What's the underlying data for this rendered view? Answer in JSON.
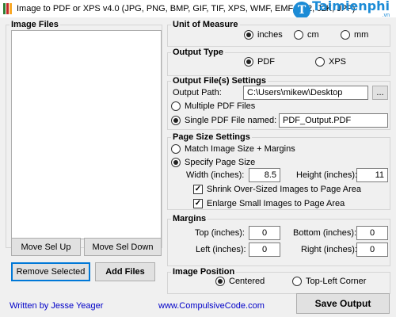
{
  "window": {
    "title": "Image to PDF or XPS  v4.0  (JPG, PNG, BMP, GIF, TIF, XPS, WMF, EMF, JP2, J2K, JPF)",
    "icon_colors": [
      "#2e7d32",
      "#c62828",
      "#f9a825"
    ]
  },
  "brand": {
    "name": "Taimienphi",
    "suffix": ".vn",
    "logo_letter": "T",
    "color": "#1b8bd6"
  },
  "image_files": {
    "title": "Image Files",
    "move_up": "Move Sel Up",
    "move_down": "Move Sel Down",
    "remove": "Remove Selected",
    "add": "Add Files"
  },
  "unit": {
    "title": "Unit of Measure",
    "inches": "inches",
    "cm": "cm",
    "mm": "mm",
    "selected": "inches"
  },
  "output_type": {
    "title": "Output Type",
    "pdf": "PDF",
    "xps": "XPS",
    "selected": "PDF"
  },
  "output_settings": {
    "title": "Output File(s) Settings",
    "path_label": "Output Path:",
    "path_value": "C:\\Users\\mikew\\Desktop",
    "browse": "...",
    "multiple": "Multiple PDF Files",
    "single": "Single PDF File named:",
    "single_value": "PDF_Output.PDF",
    "selected": "single"
  },
  "page_size": {
    "title": "Page Size Settings",
    "match": "Match Image Size + Margins",
    "specify": "Specify Page Size",
    "selected": "specify",
    "width_label": "Width (inches):",
    "width_value": "8.5",
    "height_label": "Height (inches):",
    "height_value": "11",
    "shrink": "Shrink Over-Sized Images to Page Area",
    "enlarge": "Enlarge Small Images to Page Area",
    "check_mark": "✓"
  },
  "margins": {
    "title": "Margins",
    "top_label": "Top (inches):",
    "top_value": "0",
    "bottom_label": "Bottom (inches):",
    "bottom_value": "0",
    "left_label": "Left (inches):",
    "left_value": "0",
    "right_label": "Right (inches):",
    "right_value": "0"
  },
  "image_position": {
    "title": "Image Position",
    "centered": "Centered",
    "topleft": "Top-Left Corner",
    "selected": "centered"
  },
  "footer": {
    "author": "Written by Jesse Yeager",
    "site": "www.CompulsiveCode.com",
    "save": "Save Output"
  }
}
